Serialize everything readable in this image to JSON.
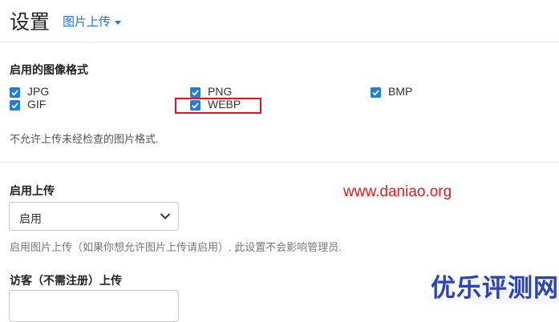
{
  "header": {
    "title": "设置",
    "dropdown_label": "图片上传"
  },
  "formats": {
    "label": "启用的图像格式",
    "options": [
      {
        "label": "JPG",
        "checked": true
      },
      {
        "label": "PNG",
        "checked": true
      },
      {
        "label": "BMP",
        "checked": true
      },
      {
        "label": "GIF",
        "checked": true
      },
      {
        "label": "WEBP",
        "checked": true
      }
    ],
    "help": "不允许上传未经检查的图片格式."
  },
  "upload": {
    "label": "启用上传",
    "selected": "启用",
    "help": "启用图片上传（如果你想允许图片上传请启用）. 此设置不会影响管理员."
  },
  "guest": {
    "label": "访客（不需注册）上传"
  },
  "watermark": {
    "url": "www.daniao.org",
    "brand": "优乐评测网"
  },
  "colors": {
    "accent": "#1e77d4",
    "highlight": "#e0141e",
    "brand": "#2b43b8"
  }
}
